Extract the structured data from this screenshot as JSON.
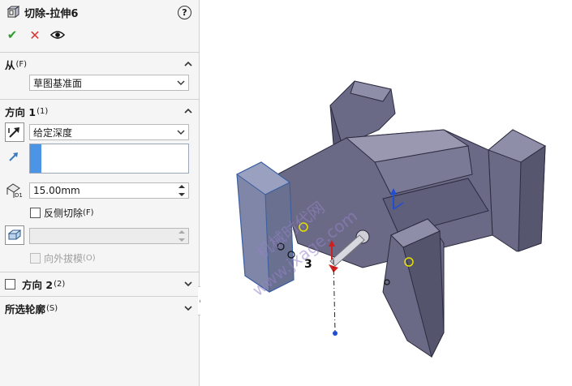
{
  "header": {
    "title": "切除-拉伸6",
    "help_label": "?"
  },
  "actions": {
    "ok_label": "✔",
    "cancel_label": "✕"
  },
  "from_group": {
    "title": "从",
    "accel": "(F)",
    "start_condition": "草图基准面"
  },
  "direction1": {
    "title": "方向 1",
    "accel": "(1)",
    "end_condition": "给定深度",
    "depth": "15.00mm",
    "flip_side_label": "反侧切除",
    "flip_side_accel": "(F)",
    "flip_side_checked": false,
    "draft_label": "向外拔模",
    "draft_accel": "(O)",
    "draft_checked": false
  },
  "direction2": {
    "title": "方向 2",
    "accel": "(2)",
    "checked": false
  },
  "selected_contours": {
    "title": "所选轮廓",
    "accel": "(S)"
  },
  "viewport": {
    "watermark_line1": "机械时代网",
    "watermark_line2": "www.jxage.com",
    "dimension_label": "3"
  },
  "colors": {
    "ok": "#2a9d2a",
    "cancel": "#dd3333",
    "active_selection": "#4b94e6",
    "part_face": "#6b6a86",
    "part_edge": "#2c2b3f",
    "highlight_face": "#7f86a8"
  }
}
